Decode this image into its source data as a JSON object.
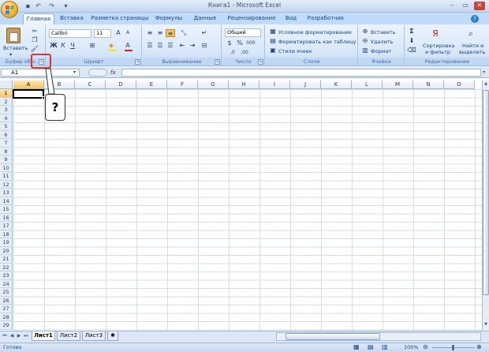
{
  "window": {
    "title": "Книга1 - Microsoft Excel"
  },
  "tabs": [
    "Главная",
    "Вставка",
    "Разметка страницы",
    "Формулы",
    "Данные",
    "Рецензирование",
    "Вид",
    "Разработчик"
  ],
  "ribbon": {
    "clipboard": {
      "label": "Буфер обм...",
      "paste": "Вставить"
    },
    "font": {
      "label": "Шрифт",
      "name": "Calibri",
      "size": "11",
      "bold": "Ж",
      "italic": "К",
      "underline": "Ч",
      "color_a": "А"
    },
    "alignment": {
      "label": "Выравнивание"
    },
    "number": {
      "label": "Число",
      "format": "Общий",
      "percent": "%",
      "thousands": "000"
    },
    "styles": {
      "label": "Стили",
      "conditional": "Условное форматирование",
      "as_table": "Форматировать как таблицу",
      "cell_styles": "Стили ячеек"
    },
    "cells": {
      "label": "Ячейки",
      "insert": "Вставить",
      "delete": "Удалить",
      "format": "Формат"
    },
    "editing": {
      "label": "Редактирование",
      "sigma": "Σ",
      "sort_1": "Сортировка",
      "sort_2": "и фильтр",
      "find_1": "Найти и",
      "find_2": "выделить"
    }
  },
  "formula_bar": {
    "name_box": "A1",
    "fx": "fx",
    "formula": ""
  },
  "columns": [
    "A",
    "B",
    "C",
    "D",
    "E",
    "F",
    "G",
    "H",
    "I",
    "J",
    "K",
    "L",
    "M",
    "N",
    "O"
  ],
  "rows": [
    "1",
    "2",
    "3",
    "4",
    "5",
    "6",
    "7",
    "8",
    "9",
    "10",
    "11",
    "12",
    "13",
    "14",
    "15",
    "16",
    "17",
    "18",
    "19",
    "20",
    "21",
    "22",
    "23",
    "24",
    "25",
    "26",
    "27",
    "28",
    "29"
  ],
  "sheets": [
    "Лист1",
    "Лист2",
    "Лист3"
  ],
  "status": {
    "ready": "Готово",
    "zoom": "100%"
  },
  "callout": {
    "text": "?"
  },
  "colors": {
    "highlight": "#e03030",
    "active_header": "#f8c55f"
  }
}
